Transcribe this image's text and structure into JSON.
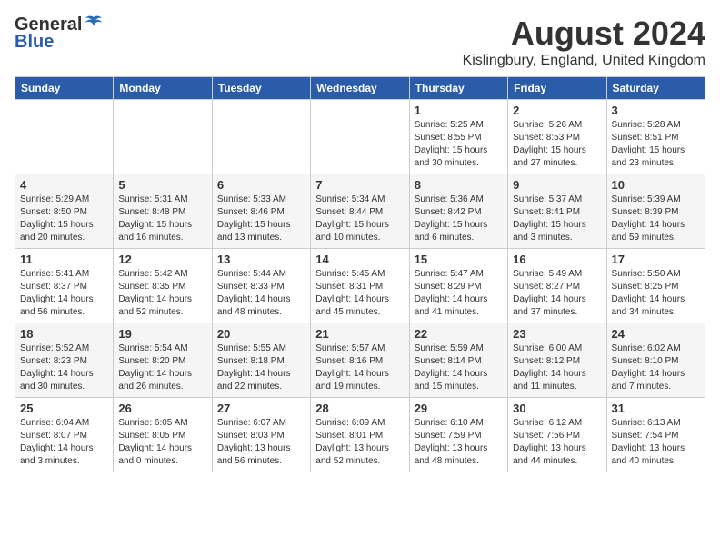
{
  "header": {
    "logo_general": "General",
    "logo_blue": "Blue",
    "month": "August 2024",
    "location": "Kislingbury, England, United Kingdom"
  },
  "days_of_week": [
    "Sunday",
    "Monday",
    "Tuesday",
    "Wednesday",
    "Thursday",
    "Friday",
    "Saturday"
  ],
  "weeks": [
    [
      {
        "day": "",
        "info": ""
      },
      {
        "day": "",
        "info": ""
      },
      {
        "day": "",
        "info": ""
      },
      {
        "day": "",
        "info": ""
      },
      {
        "day": "1",
        "sunrise": "Sunrise: 5:25 AM",
        "sunset": "Sunset: 8:55 PM",
        "daylight": "Daylight: 15 hours and 30 minutes."
      },
      {
        "day": "2",
        "sunrise": "Sunrise: 5:26 AM",
        "sunset": "Sunset: 8:53 PM",
        "daylight": "Daylight: 15 hours and 27 minutes."
      },
      {
        "day": "3",
        "sunrise": "Sunrise: 5:28 AM",
        "sunset": "Sunset: 8:51 PM",
        "daylight": "Daylight: 15 hours and 23 minutes."
      }
    ],
    [
      {
        "day": "4",
        "sunrise": "Sunrise: 5:29 AM",
        "sunset": "Sunset: 8:50 PM",
        "daylight": "Daylight: 15 hours and 20 minutes."
      },
      {
        "day": "5",
        "sunrise": "Sunrise: 5:31 AM",
        "sunset": "Sunset: 8:48 PM",
        "daylight": "Daylight: 15 hours and 16 minutes."
      },
      {
        "day": "6",
        "sunrise": "Sunrise: 5:33 AM",
        "sunset": "Sunset: 8:46 PM",
        "daylight": "Daylight: 15 hours and 13 minutes."
      },
      {
        "day": "7",
        "sunrise": "Sunrise: 5:34 AM",
        "sunset": "Sunset: 8:44 PM",
        "daylight": "Daylight: 15 hours and 10 minutes."
      },
      {
        "day": "8",
        "sunrise": "Sunrise: 5:36 AM",
        "sunset": "Sunset: 8:42 PM",
        "daylight": "Daylight: 15 hours and 6 minutes."
      },
      {
        "day": "9",
        "sunrise": "Sunrise: 5:37 AM",
        "sunset": "Sunset: 8:41 PM",
        "daylight": "Daylight: 15 hours and 3 minutes."
      },
      {
        "day": "10",
        "sunrise": "Sunrise: 5:39 AM",
        "sunset": "Sunset: 8:39 PM",
        "daylight": "Daylight: 14 hours and 59 minutes."
      }
    ],
    [
      {
        "day": "11",
        "sunrise": "Sunrise: 5:41 AM",
        "sunset": "Sunset: 8:37 PM",
        "daylight": "Daylight: 14 hours and 56 minutes."
      },
      {
        "day": "12",
        "sunrise": "Sunrise: 5:42 AM",
        "sunset": "Sunset: 8:35 PM",
        "daylight": "Daylight: 14 hours and 52 minutes."
      },
      {
        "day": "13",
        "sunrise": "Sunrise: 5:44 AM",
        "sunset": "Sunset: 8:33 PM",
        "daylight": "Daylight: 14 hours and 48 minutes."
      },
      {
        "day": "14",
        "sunrise": "Sunrise: 5:45 AM",
        "sunset": "Sunset: 8:31 PM",
        "daylight": "Daylight: 14 hours and 45 minutes."
      },
      {
        "day": "15",
        "sunrise": "Sunrise: 5:47 AM",
        "sunset": "Sunset: 8:29 PM",
        "daylight": "Daylight: 14 hours and 41 minutes."
      },
      {
        "day": "16",
        "sunrise": "Sunrise: 5:49 AM",
        "sunset": "Sunset: 8:27 PM",
        "daylight": "Daylight: 14 hours and 37 minutes."
      },
      {
        "day": "17",
        "sunrise": "Sunrise: 5:50 AM",
        "sunset": "Sunset: 8:25 PM",
        "daylight": "Daylight: 14 hours and 34 minutes."
      }
    ],
    [
      {
        "day": "18",
        "sunrise": "Sunrise: 5:52 AM",
        "sunset": "Sunset: 8:23 PM",
        "daylight": "Daylight: 14 hours and 30 minutes."
      },
      {
        "day": "19",
        "sunrise": "Sunrise: 5:54 AM",
        "sunset": "Sunset: 8:20 PM",
        "daylight": "Daylight: 14 hours and 26 minutes."
      },
      {
        "day": "20",
        "sunrise": "Sunrise: 5:55 AM",
        "sunset": "Sunset: 8:18 PM",
        "daylight": "Daylight: 14 hours and 22 minutes."
      },
      {
        "day": "21",
        "sunrise": "Sunrise: 5:57 AM",
        "sunset": "Sunset: 8:16 PM",
        "daylight": "Daylight: 14 hours and 19 minutes."
      },
      {
        "day": "22",
        "sunrise": "Sunrise: 5:59 AM",
        "sunset": "Sunset: 8:14 PM",
        "daylight": "Daylight: 14 hours and 15 minutes."
      },
      {
        "day": "23",
        "sunrise": "Sunrise: 6:00 AM",
        "sunset": "Sunset: 8:12 PM",
        "daylight": "Daylight: 14 hours and 11 minutes."
      },
      {
        "day": "24",
        "sunrise": "Sunrise: 6:02 AM",
        "sunset": "Sunset: 8:10 PM",
        "daylight": "Daylight: 14 hours and 7 minutes."
      }
    ],
    [
      {
        "day": "25",
        "sunrise": "Sunrise: 6:04 AM",
        "sunset": "Sunset: 8:07 PM",
        "daylight": "Daylight: 14 hours and 3 minutes."
      },
      {
        "day": "26",
        "sunrise": "Sunrise: 6:05 AM",
        "sunset": "Sunset: 8:05 PM",
        "daylight": "Daylight: 14 hours and 0 minutes."
      },
      {
        "day": "27",
        "sunrise": "Sunrise: 6:07 AM",
        "sunset": "Sunset: 8:03 PM",
        "daylight": "Daylight: 13 hours and 56 minutes."
      },
      {
        "day": "28",
        "sunrise": "Sunrise: 6:09 AM",
        "sunset": "Sunset: 8:01 PM",
        "daylight": "Daylight: 13 hours and 52 minutes."
      },
      {
        "day": "29",
        "sunrise": "Sunrise: 6:10 AM",
        "sunset": "Sunset: 7:59 PM",
        "daylight": "Daylight: 13 hours and 48 minutes."
      },
      {
        "day": "30",
        "sunrise": "Sunrise: 6:12 AM",
        "sunset": "Sunset: 7:56 PM",
        "daylight": "Daylight: 13 hours and 44 minutes."
      },
      {
        "day": "31",
        "sunrise": "Sunrise: 6:13 AM",
        "sunset": "Sunset: 7:54 PM",
        "daylight": "Daylight: 13 hours and 40 minutes."
      }
    ]
  ]
}
